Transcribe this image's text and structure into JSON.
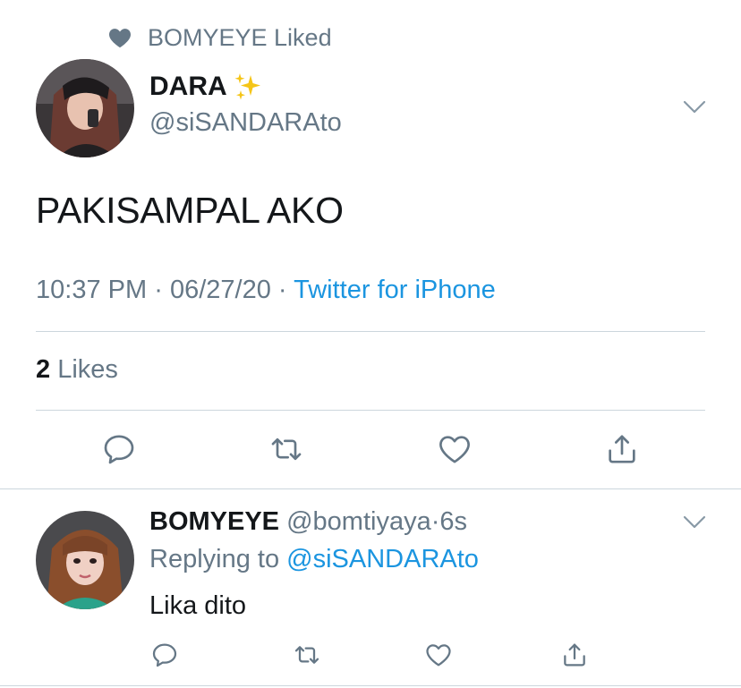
{
  "social_context": {
    "icon": "heart-filled-icon",
    "text": "BOMYEYE Liked"
  },
  "tweet": {
    "author_name": "DARA",
    "author_emoji": "✨",
    "author_handle": "@siSANDARAto",
    "text": "PAKISAMPAL AKO",
    "time": "10:37 PM",
    "date": "06/27/20",
    "separator": "·",
    "source": "Twitter for iPhone",
    "likes_count": "2",
    "likes_label": "Likes"
  },
  "reply": {
    "author_name": "BOMYEYE",
    "author_handle": "@bomtiyaya",
    "separator": "·",
    "time_ago": "6s",
    "replying_prefix": "Replying to",
    "replying_handle": "@siSANDARAto",
    "text": "Lika dito"
  },
  "colors": {
    "text": "#14171a",
    "muted": "#657786",
    "link": "#1b95e0",
    "divider": "#ccd6dd"
  }
}
